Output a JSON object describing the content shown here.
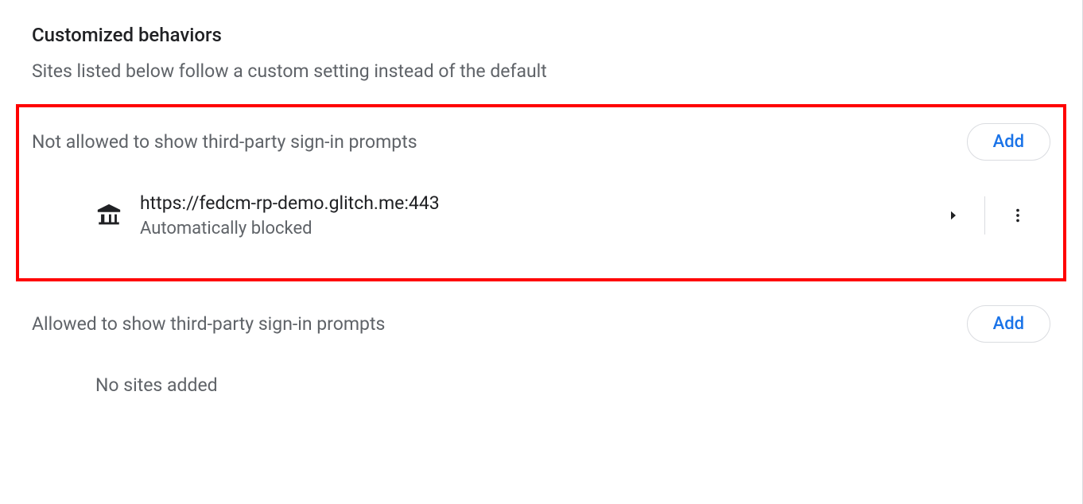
{
  "customized": {
    "title": "Customized behaviors",
    "description": "Sites listed below follow a custom setting instead of the default"
  },
  "notAllowed": {
    "heading": "Not allowed to show third-party sign-in prompts",
    "addLabel": "Add",
    "sites": [
      {
        "url": "https://fedcm-rp-demo.glitch.me:443",
        "status": "Automatically blocked"
      }
    ]
  },
  "allowed": {
    "heading": "Allowed to show third-party sign-in prompts",
    "addLabel": "Add",
    "emptyText": "No sites added"
  }
}
